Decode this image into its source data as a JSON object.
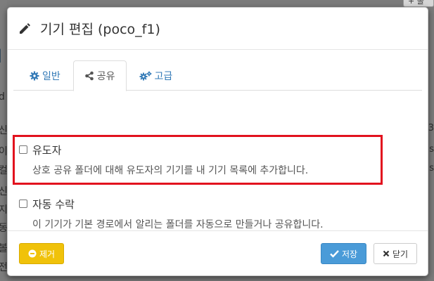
{
  "background": {
    "top_button_label": "+ 폴",
    "left_chars": [
      "d",
      "신",
      "이",
      "컬",
      "신",
      "지",
      "동",
      "볼",
      "전"
    ],
    "right_chars": [
      "3",
      "s",
      "s"
    ]
  },
  "modal": {
    "title": "기기 편집 (poco_f1)",
    "tabs": [
      {
        "label": "일반",
        "icon": "gear-icon"
      },
      {
        "label": "공유",
        "icon": "share-icon"
      },
      {
        "label": "고급",
        "icon": "gears-icon"
      }
    ],
    "active_tab": "공유",
    "options": [
      {
        "label": "유도자",
        "checked": false,
        "description": "상호 공유 폴더에 대해 유도자의 기기를 내 기기 목록에 추가합니다."
      },
      {
        "label": "자동 수락",
        "checked": false,
        "description": "이 기기가 기본 경로에서 알리는 폴더를 자동으로 만들거나 공유합니다."
      }
    ],
    "footer": {
      "remove_label": "제거",
      "save_label": "저장",
      "close_label": "닫기"
    },
    "colors": {
      "highlight": "#e2121e",
      "remove": "#f0c20a",
      "save": "#4a9bd8",
      "link": "#337ab7"
    }
  }
}
